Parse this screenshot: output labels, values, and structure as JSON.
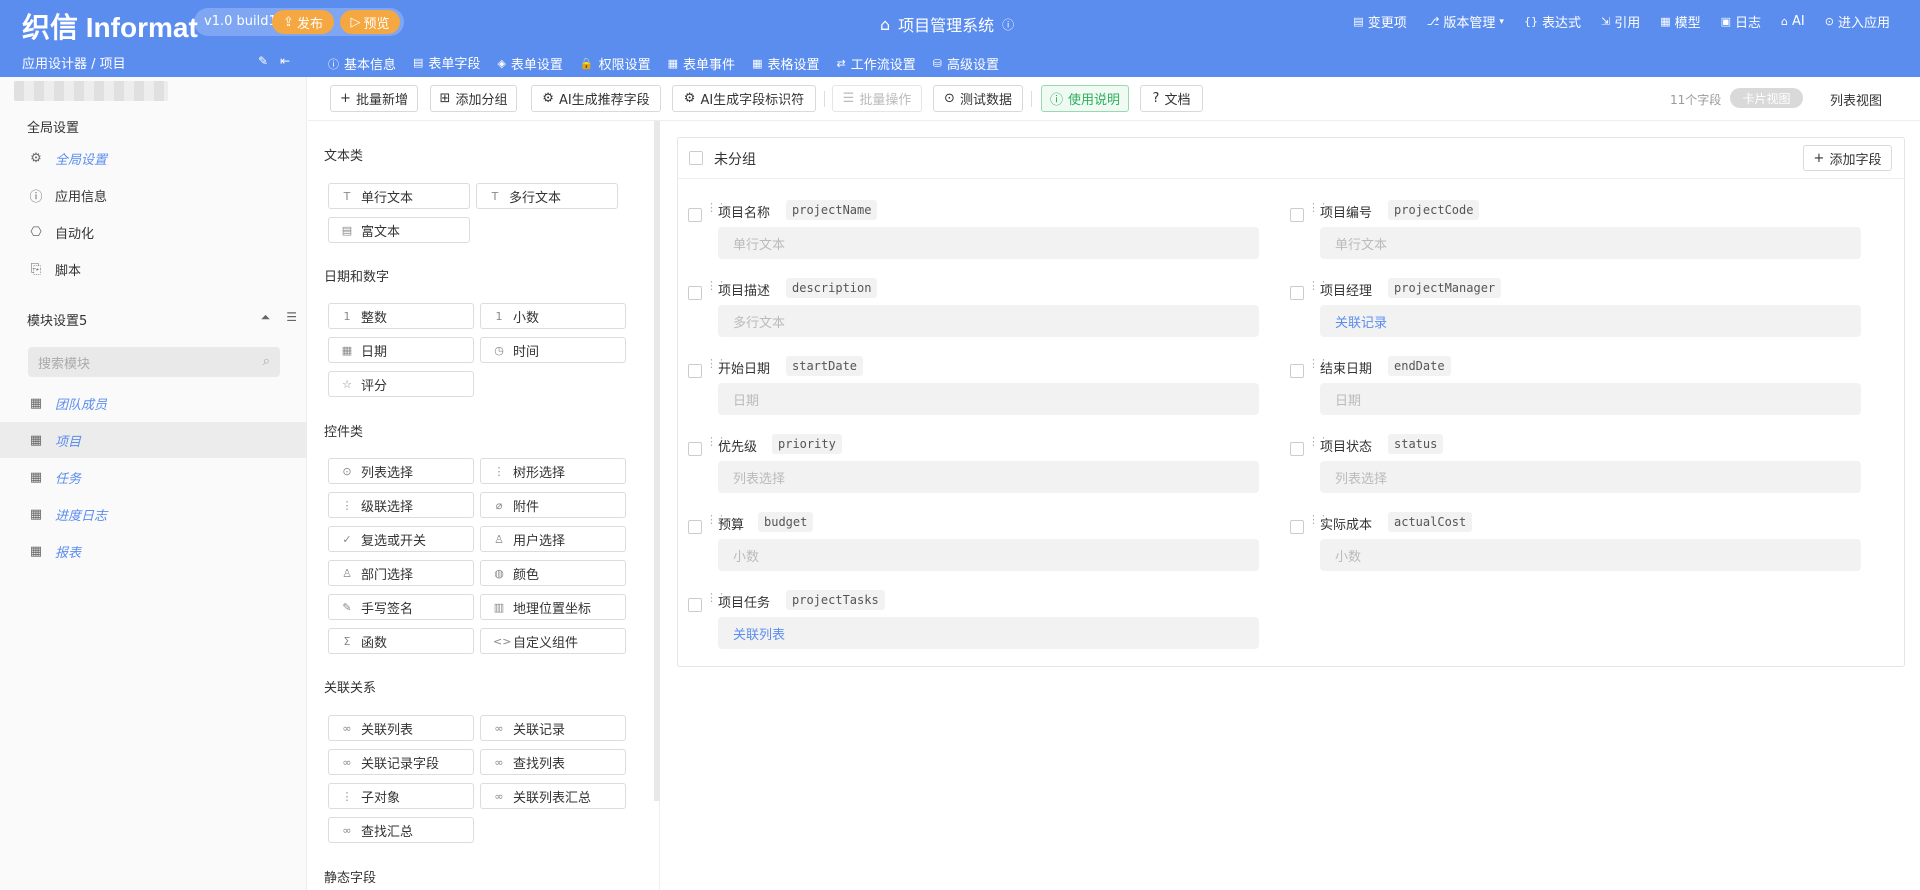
{
  "header": {
    "logo": "织信 Informat",
    "version": "v1.0 build1",
    "publish": "发布",
    "preview": "预览",
    "app_title": "项目管理系统",
    "right": [
      {
        "icon": "▤",
        "label": "变更项"
      },
      {
        "icon": "⎇",
        "label": "版本管理"
      },
      {
        "icon": "{}",
        "label": "表达式"
      },
      {
        "icon": "⇲",
        "label": "引用"
      },
      {
        "icon": "▦",
        "label": "模型"
      },
      {
        "icon": "▣",
        "label": "日志"
      },
      {
        "icon": "⌂",
        "label": "AI"
      },
      {
        "icon": "⊙",
        "label": "进入应用"
      }
    ]
  },
  "breadcrumb": "应用设计器 / 项目",
  "tabs": [
    {
      "icon": "ⓘ",
      "label": "基本信息"
    },
    {
      "icon": "▤",
      "label": "表单字段"
    },
    {
      "icon": "◈",
      "label": "表单设置"
    },
    {
      "icon": "🔒",
      "label": "权限设置"
    },
    {
      "icon": "▦",
      "label": "表单事件"
    },
    {
      "icon": "▦",
      "label": "表格设置"
    },
    {
      "icon": "⇄",
      "label": "工作流设置"
    },
    {
      "icon": "⛁",
      "label": "高级设置"
    }
  ],
  "sidebar": {
    "global_section": "全局设置",
    "items": [
      {
        "icon": "⚙",
        "label": "全局设置"
      },
      {
        "icon": "ⓘ",
        "label": "应用信息"
      },
      {
        "icon": "⎔",
        "label": "自动化"
      },
      {
        "icon": "⎘",
        "label": "脚本"
      }
    ],
    "module_section": "模块设置5",
    "search_placeholder": "搜索模块",
    "modules": [
      {
        "label": "团队成员"
      },
      {
        "label": "项目"
      },
      {
        "label": "任务"
      },
      {
        "label": "进度日志"
      },
      {
        "label": "报表"
      }
    ]
  },
  "toolbar": {
    "buttons": [
      {
        "icon": "+",
        "label": "批量新增"
      },
      {
        "icon": "⊞",
        "label": "添加分组"
      },
      {
        "icon": "⚙",
        "label": "AI生成推荐字段"
      },
      {
        "icon": "⚙",
        "label": "AI生成字段标识符"
      },
      {
        "icon": "☰",
        "label": "批量操作"
      },
      {
        "icon": "⊙",
        "label": "测试数据"
      },
      {
        "icon": "ⓘ",
        "label": "使用说明"
      },
      {
        "icon": "?",
        "label": "文档"
      }
    ],
    "field_count": "11个字段",
    "card_view": "卡片视图",
    "list_view": "列表视图"
  },
  "palette": {
    "categories": {
      "text": "文本类",
      "datenum": "日期和数字",
      "control": "控件类",
      "relation": "关联关系",
      "static": "静态字段"
    },
    "text_fields": [
      {
        "icon": "T",
        "label": "单行文本"
      },
      {
        "icon": "T",
        "label": "多行文本"
      },
      {
        "icon": "▤",
        "label": "富文本"
      }
    ],
    "datenum_fields": [
      {
        "icon": "1",
        "label": "整数"
      },
      {
        "icon": "1",
        "label": "小数"
      },
      {
        "icon": "▦",
        "label": "日期"
      },
      {
        "icon": "◷",
        "label": "时间"
      },
      {
        "icon": "☆",
        "label": "评分"
      }
    ],
    "control_fields": [
      {
        "icon": "⊙",
        "label": "列表选择"
      },
      {
        "icon": "⋮",
        "label": "树形选择"
      },
      {
        "icon": "⋮",
        "label": "级联选择"
      },
      {
        "icon": "⌀",
        "label": "附件"
      },
      {
        "icon": "✓",
        "label": "复选或开关"
      },
      {
        "icon": "♙",
        "label": "用户选择"
      },
      {
        "icon": "♙",
        "label": "部门选择"
      },
      {
        "icon": "◍",
        "label": "颜色"
      },
      {
        "icon": "✎",
        "label": "手写签名"
      },
      {
        "icon": "▥",
        "label": "地理位置坐标"
      },
      {
        "icon": "Σ",
        "label": "函数"
      },
      {
        "icon": "<>",
        "label": "自定义组件"
      }
    ],
    "relation_fields": [
      {
        "icon": "∞",
        "label": "关联列表"
      },
      {
        "icon": "∞",
        "label": "关联记录"
      },
      {
        "icon": "∞",
        "label": "关联记录字段"
      },
      {
        "icon": "∞",
        "label": "查找列表"
      },
      {
        "icon": "⋮",
        "label": "子对象"
      },
      {
        "icon": "∞",
        "label": "关联列表汇总"
      },
      {
        "icon": "∞",
        "label": "查找汇总"
      }
    ]
  },
  "canvas": {
    "group_title": "未分组",
    "add_field": "添加字段",
    "fields": [
      {
        "label": "项目名称",
        "code": "projectName",
        "placeholder": "单行文本",
        "link": false
      },
      {
        "label": "项目编号",
        "code": "projectCode",
        "placeholder": "单行文本",
        "link": false
      },
      {
        "label": "项目描述",
        "code": "description",
        "placeholder": "多行文本",
        "link": false
      },
      {
        "label": "项目经理",
        "code": "projectManager",
        "placeholder": "关联记录",
        "link": true
      },
      {
        "label": "开始日期",
        "code": "startDate",
        "placeholder": "日期",
        "link": false
      },
      {
        "label": "结束日期",
        "code": "endDate",
        "placeholder": "日期",
        "link": false
      },
      {
        "label": "优先级",
        "code": "priority",
        "placeholder": "列表选择",
        "link": false
      },
      {
        "label": "项目状态",
        "code": "status",
        "placeholder": "列表选择",
        "link": false
      },
      {
        "label": "预算",
        "code": "budget",
        "placeholder": "小数",
        "link": false
      },
      {
        "label": "实际成本",
        "code": "actualCost",
        "placeholder": "小数",
        "link": false
      },
      {
        "label": "项目任务",
        "code": "projectTasks",
        "placeholder": "关联列表",
        "link": true
      }
    ]
  },
  "colors": {
    "header_blue": "#5b8def",
    "accent_orange": "#f5a742",
    "link_blue": "#5b8def",
    "green": "#2fae5c"
  }
}
